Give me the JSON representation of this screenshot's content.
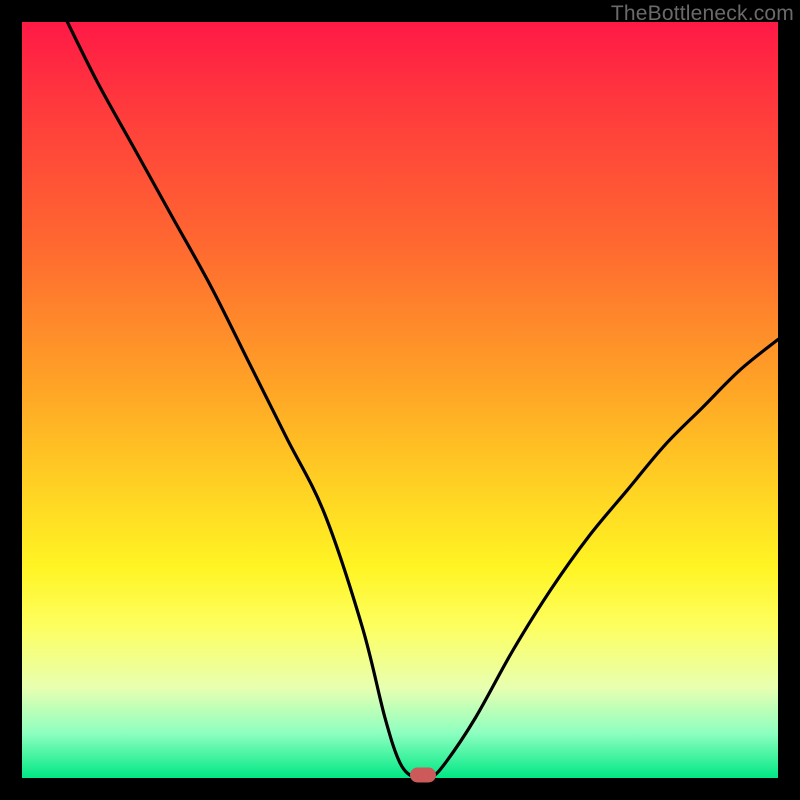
{
  "watermark": "TheBottleneck.com",
  "chart_data": {
    "type": "line",
    "title": "",
    "xlabel": "",
    "ylabel": "",
    "xlim": [
      0,
      100
    ],
    "ylim": [
      0,
      100
    ],
    "series": [
      {
        "name": "bottleneck-curve",
        "x": [
          6,
          10,
          15,
          20,
          25,
          30,
          35,
          40,
          45,
          48,
          50,
          52,
          54,
          56,
          60,
          65,
          70,
          75,
          80,
          85,
          90,
          95,
          100
        ],
        "y": [
          100,
          92,
          83,
          74,
          65,
          55,
          45,
          35,
          20,
          8,
          2,
          0,
          0,
          2,
          8,
          17,
          25,
          32,
          38,
          44,
          49,
          54,
          58
        ]
      }
    ],
    "marker": {
      "x": 53,
      "y": 0,
      "label": "optimal-point"
    },
    "background_gradient": {
      "top": "#ff1946",
      "bottom": "#00e884",
      "midtones": [
        "#ff6a30",
        "#ffd323",
        "#fdff60"
      ]
    }
  }
}
